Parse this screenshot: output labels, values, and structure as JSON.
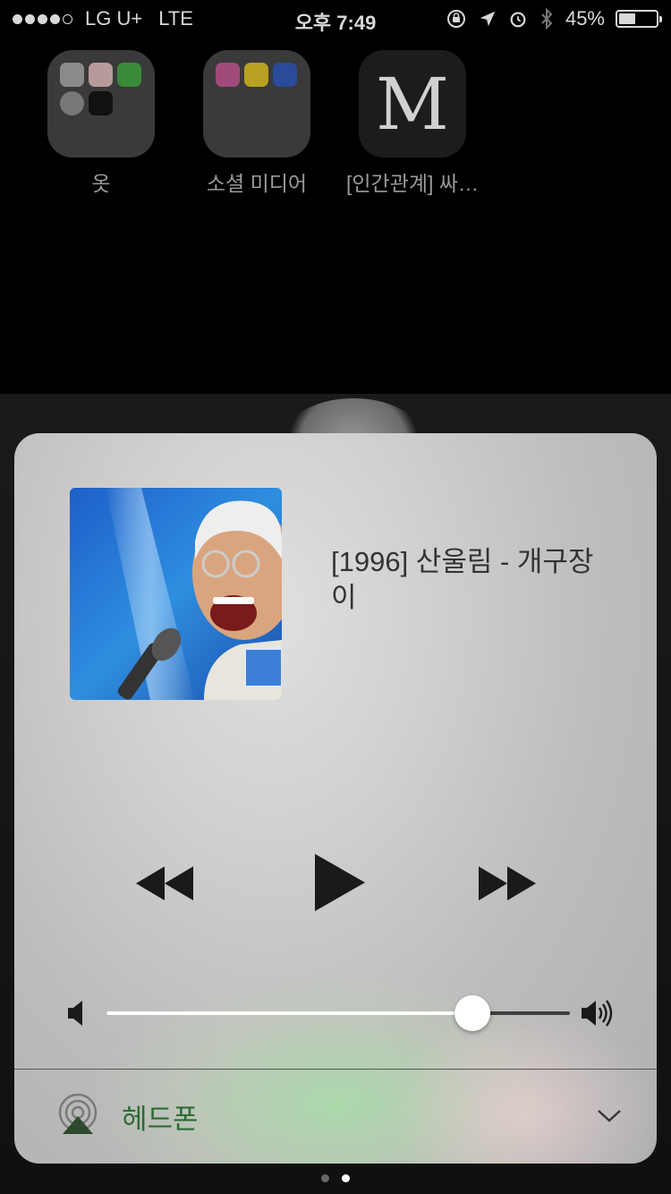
{
  "status_bar": {
    "carrier": "LG U+",
    "network": "LTE",
    "time": "오후 7:49",
    "battery_percent": "45%",
    "battery_level": 0.45
  },
  "home_icons": [
    {
      "label": "옷"
    },
    {
      "label": "소셜 미디어"
    },
    {
      "label": "[인간관계] 싸…",
      "glyph": "M"
    }
  ],
  "now_playing": {
    "title": "[1996] 산울림 - 개구장이"
  },
  "volume": {
    "level": 0.79
  },
  "route": {
    "label": "헤드폰"
  },
  "pager": {
    "count": 2,
    "active": 1
  },
  "colors": {
    "route_green": "#2e6b34",
    "card_bg": "#c8c8c8"
  }
}
